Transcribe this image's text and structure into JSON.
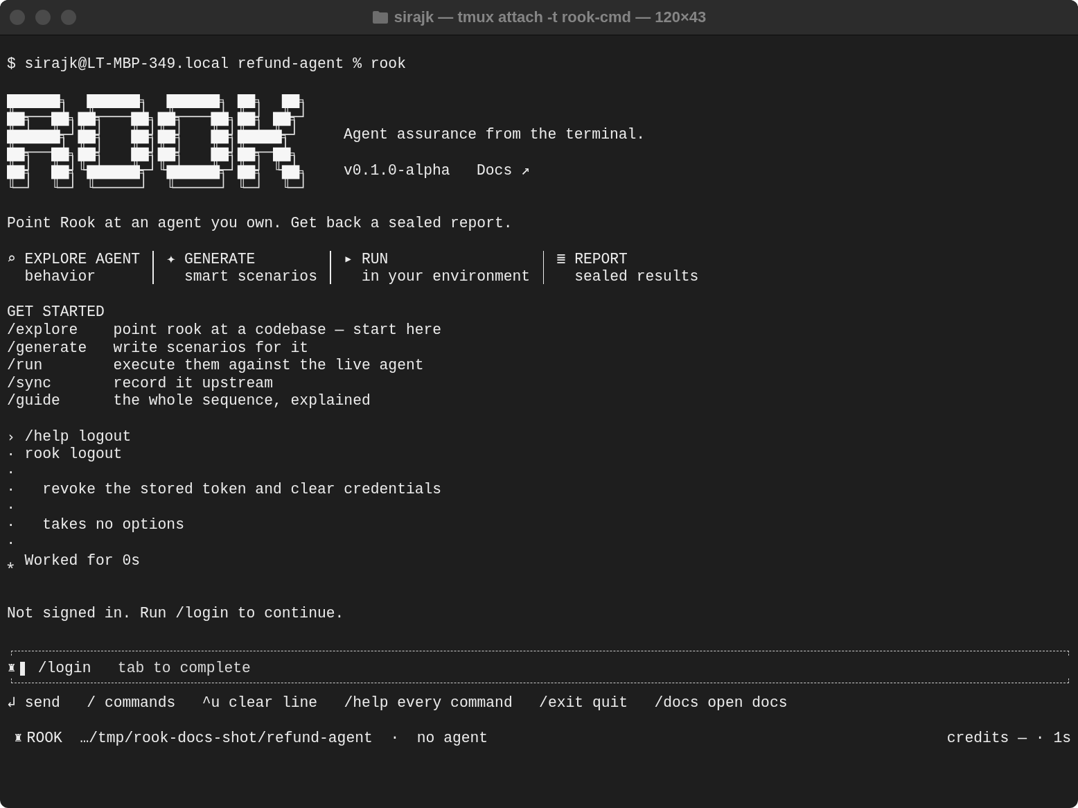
{
  "window": {
    "title": "sirajk — tmux attach -t rook-cmd — 120×43"
  },
  "prompt": {
    "text": "$ sirajk@LT-MBP-349.local refund-agent % rook"
  },
  "header": {
    "tagline": "Agent assurance from the terminal.",
    "version": "v0.1.0-alpha",
    "docs_link": "Docs ↗"
  },
  "intro": "Point Rook at an agent you own. Get back a sealed report.",
  "features": [
    {
      "icon": "⌕",
      "title": "EXPLORE AGENT",
      "subtitle": "behavior"
    },
    {
      "icon": "✦",
      "title": "GENERATE",
      "subtitle": "smart scenarios"
    },
    {
      "icon": "▸",
      "title": "RUN",
      "subtitle": "in your environment"
    },
    {
      "icon": "≣",
      "title": "REPORT",
      "subtitle": "sealed results"
    }
  ],
  "get_started": {
    "heading": "GET STARTED",
    "commands": [
      {
        "command": "/explore",
        "description": "point rook at a codebase — start here"
      },
      {
        "command": "/generate",
        "description": "write scenarios for it"
      },
      {
        "command": "/run",
        "description": "execute them against the live agent"
      },
      {
        "command": "/sync",
        "description": "record it upstream"
      },
      {
        "command": "/guide",
        "description": "the whole sequence, explained"
      }
    ]
  },
  "output_lines": [
    {
      "kind": "line",
      "marker": "›",
      "text": "/help logout"
    },
    {
      "kind": "line",
      "marker": "·",
      "text": "rook logout"
    },
    {
      "marker": "·"
    },
    {
      "kind": "detail",
      "marker": "·",
      "text": "revoke the stored token and clear credentials"
    },
    {
      "marker": "·"
    },
    {
      "kind": "detail",
      "marker": "·",
      "text": "takes no options"
    },
    {
      "marker": "·"
    },
    {
      "kind": "line",
      "marker": "⁎",
      "text": "Worked for 0s"
    }
  ],
  "notice": "Not signed in. Run /login to continue.",
  "input": {
    "prefix": "♜",
    "value": "/login",
    "hint": "tab to complete"
  },
  "shortcuts": [
    {
      "key": "↲",
      "label": "send"
    },
    {
      "key": "/",
      "label": "commands"
    },
    {
      "key": "^u",
      "label": "clear line"
    },
    {
      "key": "/help",
      "label": "every command"
    },
    {
      "key": "/exit",
      "label": "quit"
    },
    {
      "key": "/docs",
      "label": "open docs"
    }
  ],
  "status_bar": {
    "icon": "♜",
    "name": "ROOK",
    "path": "…/tmp/rook-docs-shot/refund-agent",
    "separator": "·",
    "agent": "no agent",
    "credits": "credits — · 1s"
  }
}
